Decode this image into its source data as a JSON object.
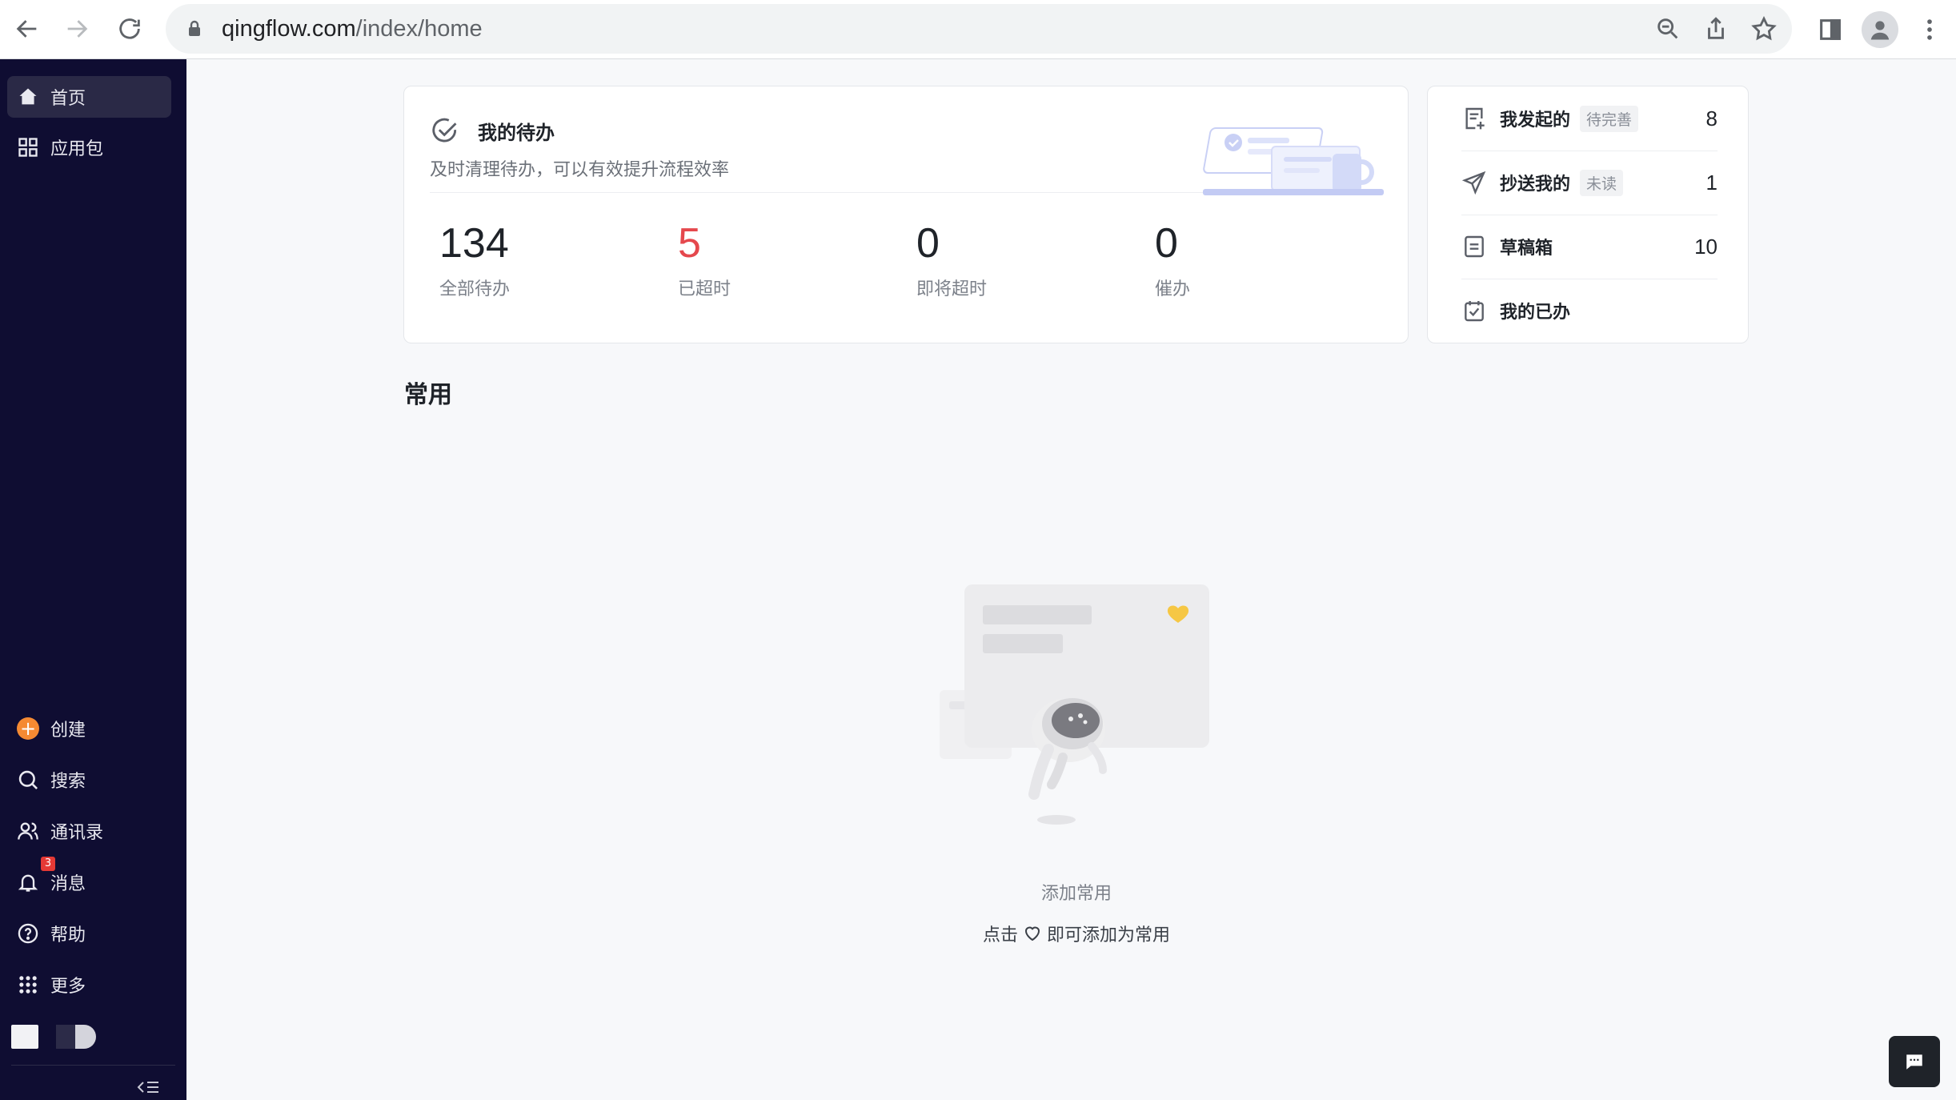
{
  "browser": {
    "url_host": "qingflow.com",
    "url_path": "/index/home"
  },
  "sidebar": {
    "top_items": [
      {
        "label": "首页",
        "icon": "home-icon",
        "active": true
      },
      {
        "label": "应用包",
        "icon": "apps-grid-icon",
        "active": false
      }
    ],
    "bottom_items": [
      {
        "label": "创建",
        "icon": "plus-circle-icon"
      },
      {
        "label": "搜索",
        "icon": "search-icon"
      },
      {
        "label": "通讯录",
        "icon": "contacts-icon"
      },
      {
        "label": "消息",
        "icon": "bell-icon",
        "badge": "3"
      },
      {
        "label": "帮助",
        "icon": "help-icon"
      },
      {
        "label": "更多",
        "icon": "dots-grid-icon"
      }
    ]
  },
  "todo": {
    "title": "我的待办",
    "description": "及时清理待办，可以有效提升流程效率",
    "stats": [
      {
        "value": "134",
        "label": "全部待办",
        "color": "#1f2329"
      },
      {
        "value": "5",
        "label": "已超时",
        "color": "#e5484d"
      },
      {
        "value": "0",
        "label": "即将超时",
        "color": "#1f2329"
      },
      {
        "value": "0",
        "label": "催办",
        "color": "#1f2329"
      }
    ]
  },
  "shortcuts": [
    {
      "label": "我发起的",
      "tag": "待完善",
      "count": "8",
      "icon": "doc-plus-icon"
    },
    {
      "label": "抄送我的",
      "tag": "未读",
      "count": "1",
      "icon": "send-icon"
    },
    {
      "label": "草稿箱",
      "tag": "",
      "count": "10",
      "icon": "draft-icon"
    },
    {
      "label": "我的已办",
      "tag": "",
      "count": "",
      "icon": "calendar-check-icon"
    }
  ],
  "common": {
    "title": "常用",
    "empty_title": "添加常用",
    "empty_hint_before": "点击",
    "empty_hint_after": "即可添加为常用"
  },
  "colors": {
    "sidebar_bg": "#0f0d32",
    "accent_orange": "#f58a33",
    "overdue_red": "#e5484d"
  }
}
